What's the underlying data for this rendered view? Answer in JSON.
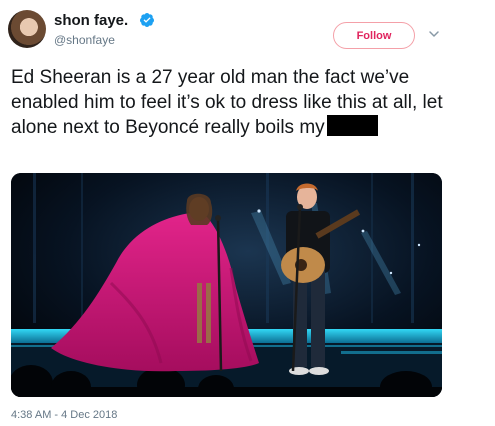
{
  "user": {
    "display_name": "shon faye.",
    "handle": "@shonfaye",
    "verified": true,
    "avatar_icon": "profile-photo"
  },
  "actions": {
    "follow_label": "Follow",
    "more_icon": "chevron-down-icon"
  },
  "tweet": {
    "text": "Ed Sheeran is a 27 year old man the fact we’ve enabled him to feel it’s ok to dress like this at all, let alone next to Beyoncé really boils my",
    "redacted_word": true,
    "timestamp": "4:38 AM - 4 Dec 2018"
  },
  "media": {
    "description_icon": "concert-stage-photo"
  },
  "colors": {
    "follow_accent": "#e0245e",
    "verified_blue": "#1da1f2",
    "secondary_text": "#657786",
    "gown_pink": "#d2147a",
    "stage_cyan": "#19c4e8"
  }
}
